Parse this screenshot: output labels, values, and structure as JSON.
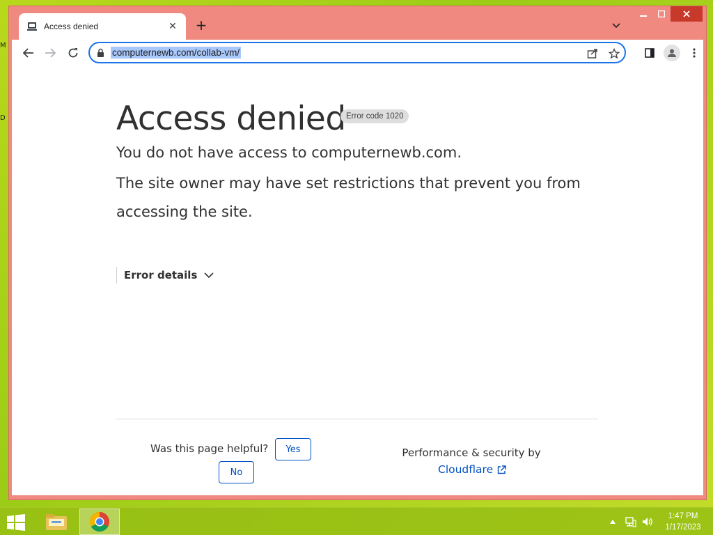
{
  "browser": {
    "tab_title": "Access denied",
    "url": "computernewb.com/collab-vm/"
  },
  "page": {
    "heading": "Access denied",
    "error_badge": "Error code 1020",
    "subtitle": "You do not have access to computernewb.com.",
    "description": "The site owner may have set restrictions that prevent you from accessing the site.",
    "error_details_label": "Error details",
    "helpful_question": "Was this page helpful?",
    "yes_label": "Yes",
    "no_label": "No",
    "perf_label": "Performance & security by",
    "cloudflare_label": "Cloudflare"
  },
  "taskbar": {
    "time": "1:47 PM",
    "date": "1/17/2023"
  },
  "desktop": {
    "fragments": [
      "M",
      "D"
    ]
  },
  "colors": {
    "titlebar": "#f08a80",
    "link": "#0051c3",
    "omnibox_focus": "#1a73e8",
    "url_highlight": "#a8c7fa",
    "desktop": "#9ccc17"
  }
}
